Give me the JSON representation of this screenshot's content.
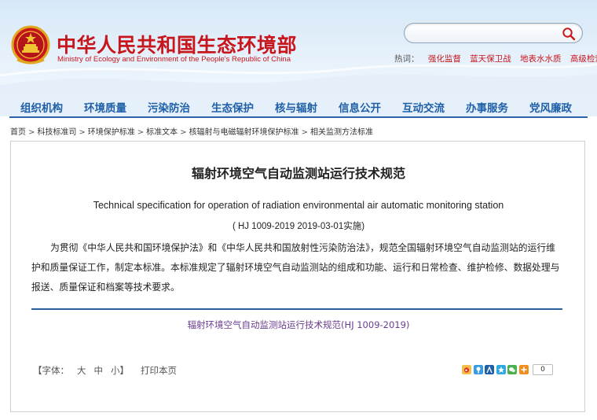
{
  "header": {
    "title_cn": "中华人民共和国生态环境部",
    "title_en": "Ministry of Ecology and Environment of the People's Republic of China"
  },
  "search": {
    "placeholder": "",
    "value": ""
  },
  "hot": {
    "label": "热词：",
    "items": [
      "强化监督",
      "蓝天保卫战",
      "地表水水质",
      "高级检索"
    ]
  },
  "nav": {
    "items": [
      "组织机构",
      "环境质量",
      "污染防治",
      "生态保护",
      "核与辐射",
      "信息公开",
      "互动交流",
      "办事服务",
      "党风廉政"
    ]
  },
  "breadcrumb": {
    "items": [
      "首页",
      "科技标准司",
      "环境保护标准",
      "标准文本",
      "核辐射与电磁辐射环境保护标准",
      "相关监测方法标准"
    ],
    "separator": ">"
  },
  "document": {
    "title": "辐射环境空气自动监测站运行技术规范",
    "title_en": "Technical specification for operation of radiation environmental air automatic monitoring station",
    "code": "( HJ 1009-2019 2019-03-01实施)",
    "body": "为贯彻《中华人民共和国环境保护法》和《中华人民共和国放射性污染防治法》，规范全国辐射环境空气自动监测站的运行维护和质量保证工作，制定本标准。本标准规定了辐射环境空气自动监测站的组成和功能、运行和日常检查、维护检修、数据处理与报送、质量保证和档案等技术要求。",
    "attachment": "辐射环境空气自动监测站运行技术规范(HJ 1009-2019)"
  },
  "tools": {
    "font_label": "【字体：",
    "font_large": "大",
    "font_medium": "中",
    "font_small": "小】",
    "print": "打印本页",
    "share_count": "0"
  },
  "colors": {
    "brand_red": "#c8161d",
    "nav_blue": "#1f5fa8",
    "rule_blue": "#2a5f9e",
    "attachment_purple": "#6a3d8f"
  },
  "icons": {
    "share": [
      "sina-weibo-icon",
      "tencent-weibo-icon",
      "renren-icon",
      "qq-space-icon",
      "wechat-icon",
      "more-share-icon"
    ]
  }
}
